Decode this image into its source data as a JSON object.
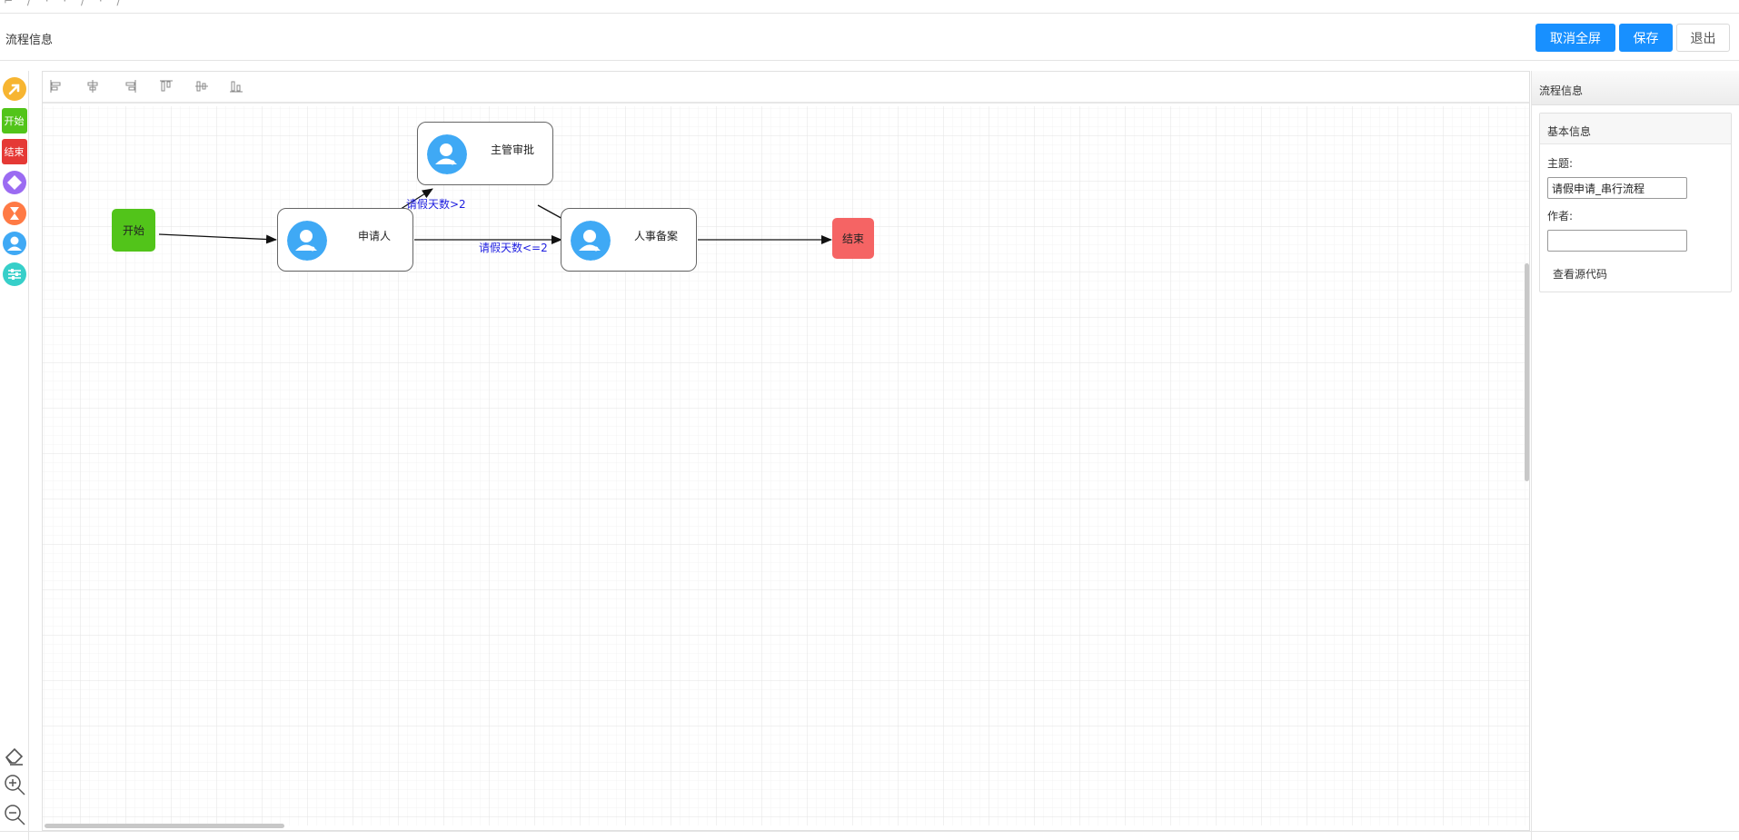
{
  "header": {
    "title": "流程信息",
    "buttons": {
      "cancel_fullscreen": "取消全屏",
      "save": "保存",
      "exit": "退出"
    }
  },
  "left_toolbar": {
    "items": [
      {
        "name": "pointer-tool",
        "icon": "arrow-up-right-icon",
        "color": "#f7b531"
      },
      {
        "name": "start-tool",
        "label": "开始",
        "color": "#52c41a"
      },
      {
        "name": "end-tool",
        "label": "结束",
        "color": "#e53935"
      },
      {
        "name": "gateway-tool",
        "icon": "diamond-icon",
        "color": "#9b6bf2"
      },
      {
        "name": "fork-tool",
        "icon": "hourglass-icon",
        "color": "#ff7a45"
      },
      {
        "name": "task-tool",
        "icon": "user-icon",
        "color": "#3fa9f5"
      },
      {
        "name": "subprocess-tool",
        "icon": "sliders-icon",
        "color": "#36cfc9"
      }
    ],
    "bottom": [
      "eraser-icon",
      "zoom-in-icon",
      "zoom-out-icon"
    ]
  },
  "diagram": {
    "nodes": {
      "start": "开始",
      "applicant": "申请人",
      "supervisor": "主管审批",
      "hr": "人事备案",
      "end": "结束"
    },
    "edges": {
      "to_supervisor": "请假天数>2",
      "to_hr": "请假天数<=2"
    }
  },
  "right_panel": {
    "title": "流程信息",
    "card_title": "基本信息",
    "subject_label": "主题:",
    "subject_value": "请假申请_串行流程",
    "author_label": "作者:",
    "author_value": "",
    "view_source": "查看源代码"
  },
  "colors": {
    "primary": "#1890ff",
    "start_node": "#52c41a",
    "end_node": "#f56464",
    "avatar": "#3fa9f5",
    "edge_label": "#2020e0"
  }
}
